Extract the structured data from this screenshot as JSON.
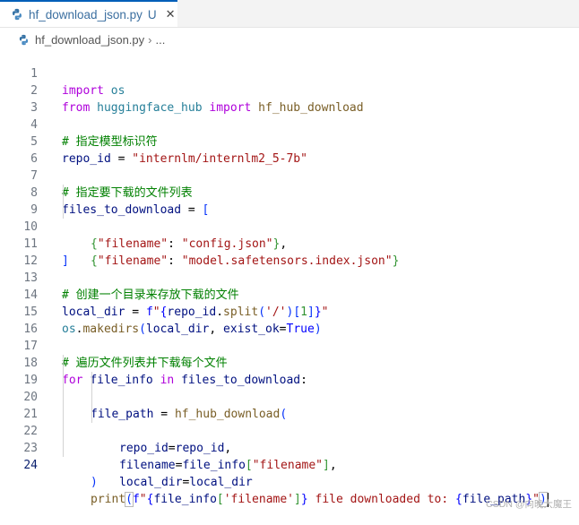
{
  "tab": {
    "filename": "hf_download_json.py",
    "status": "U"
  },
  "breadcrumb": {
    "file": "hf_download_json.py",
    "more": "..."
  },
  "lines": [
    {
      "n": "1"
    },
    {
      "n": "2"
    },
    {
      "n": "3"
    },
    {
      "n": "4"
    },
    {
      "n": "5"
    },
    {
      "n": "6"
    },
    {
      "n": "7"
    },
    {
      "n": "8"
    },
    {
      "n": "9"
    },
    {
      "n": "10"
    },
    {
      "n": "11"
    },
    {
      "n": "12"
    },
    {
      "n": "13"
    },
    {
      "n": "14"
    },
    {
      "n": "15"
    },
    {
      "n": "16"
    },
    {
      "n": "17"
    },
    {
      "n": "18"
    },
    {
      "n": "19"
    },
    {
      "n": "20"
    },
    {
      "n": "21"
    },
    {
      "n": "22"
    },
    {
      "n": "23"
    },
    {
      "n": "24"
    }
  ],
  "code": {
    "l1": {
      "import": "import",
      "os": "os"
    },
    "l2": {
      "from": "from",
      "pkg": "huggingface_hub",
      "import": "import",
      "fn": "hf_hub_download"
    },
    "l4": {
      "comment": "# 指定模型标识符"
    },
    "l5": {
      "var": "repo_id",
      "eq": " = ",
      "str": "\"internlm/internlm2_5-7b\""
    },
    "l7": {
      "comment": "# 指定要下载的文件列表"
    },
    "l8": {
      "var": "files_to_download",
      "eq": " = ",
      "open": "["
    },
    "l9": {
      "open": "{",
      "key": "\"filename\"",
      "colon": ": ",
      "val": "\"config.json\"",
      "close": "}",
      "comma": ","
    },
    "l10": {
      "open": "{",
      "key": "\"filename\"",
      "colon": ": ",
      "val": "\"model.safetensors.index.json\"",
      "close": "}"
    },
    "l11": {
      "close": "]"
    },
    "l13": {
      "comment": "# 创建一个目录来存放下载的文件"
    },
    "l14": {
      "var": "local_dir",
      "eq": " = ",
      "f": "f",
      "q1": "\"",
      "b1": "{",
      "repo": "repo_id",
      "dot": ".",
      "split": "split",
      "p1": "(",
      "arg": "'/'",
      "p2": ")",
      "idx1": "[",
      "one": "1",
      "idx2": "]",
      "b2": "}",
      "q2": "\""
    },
    "l15": {
      "os": "os",
      "dot": ".",
      "fn": "makedirs",
      "p1": "(",
      "a1": "local_dir",
      "c": ", ",
      "kw": "exist_ok",
      "eq": "=",
      "val": "True",
      "p2": ")"
    },
    "l17": {
      "comment": "# 遍历文件列表并下载每个文件"
    },
    "l18": {
      "for": "for",
      "var": "file_info",
      "in": "in",
      "iter": "files_to_download",
      "colon": ":"
    },
    "l19": {
      "var": "file_path",
      "eq": " = ",
      "fn": "hf_hub_download",
      "open": "("
    },
    "l20": {
      "kw": "repo_id",
      "eq": "=",
      "val": "repo_id",
      "comma": ","
    },
    "l21": {
      "kw": "filename",
      "eq": "=",
      "obj": "file_info",
      "o": "[",
      "key": "\"filename\"",
      "c": "]",
      "comma": ","
    },
    "l22": {
      "kw": "local_dir",
      "eq": "=",
      "val": "local_dir"
    },
    "l23": {
      "close": ")"
    },
    "l24": {
      "fn": "print",
      "p1": "(",
      "f": "f",
      "q1": "\"",
      "b1": "{",
      "obj": "file_info",
      "o": "[",
      "key": "'filename'",
      "c": "]",
      "b2": "}",
      "text": " file downloaded to: ",
      "b3": "{",
      "var": "file_path",
      "b4": "}",
      "q2": "\"",
      "p2": ")"
    }
  },
  "watermark": "CSDN @向晚大魔王"
}
